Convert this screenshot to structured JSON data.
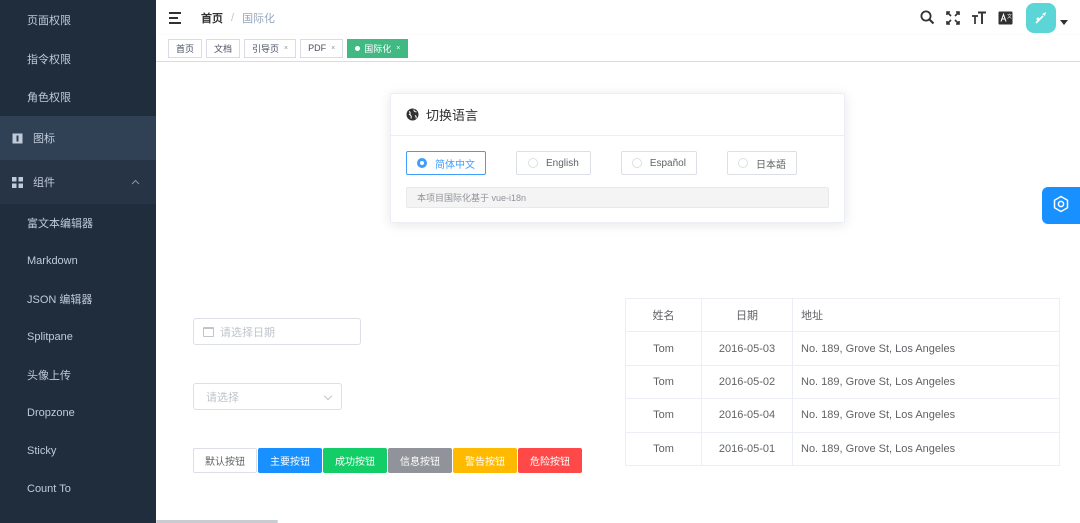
{
  "sidebar": {
    "items": [
      {
        "label": "页面权限"
      },
      {
        "label": "指令权限"
      },
      {
        "label": "角色权限"
      },
      {
        "label": "图标"
      },
      {
        "label": "组件"
      },
      {
        "label": "富文本编辑器"
      },
      {
        "label": "Markdown"
      },
      {
        "label": "JSON 编辑器"
      },
      {
        "label": "Splitpane"
      },
      {
        "label": "头像上传"
      },
      {
        "label": "Dropzone"
      },
      {
        "label": "Sticky"
      },
      {
        "label": "Count To"
      }
    ]
  },
  "breadcrumb": {
    "home": "首页",
    "separator": "/",
    "current": "国际化"
  },
  "tags": [
    {
      "label": "首页"
    },
    {
      "label": "文档"
    },
    {
      "label": "引导页"
    },
    {
      "label": "PDF"
    },
    {
      "label": "国际化"
    }
  ],
  "tag_close": "×",
  "card": {
    "title": "切换语言",
    "options": [
      {
        "label": "简体中文",
        "checked": true
      },
      {
        "label": "English",
        "checked": false
      },
      {
        "label": "Español",
        "checked": false
      },
      {
        "label": "日本語",
        "checked": false
      }
    ],
    "tip": "本项目国际化基于 vue-i18n"
  },
  "date_picker": {
    "placeholder": "请选择日期"
  },
  "select": {
    "placeholder": "请选择"
  },
  "buttons": [
    {
      "label": "默认按钮",
      "type": "default"
    },
    {
      "label": "主要按钮",
      "type": "primary"
    },
    {
      "label": "成功按钮",
      "type": "success"
    },
    {
      "label": "信息按钮",
      "type": "info"
    },
    {
      "label": "警告按钮",
      "type": "warning"
    },
    {
      "label": "危险按钮",
      "type": "danger"
    }
  ],
  "table": {
    "headers": [
      "姓名",
      "日期",
      "地址"
    ],
    "rows": [
      [
        "Tom",
        "2016-05-03",
        "No. 189, Grove St, Los Angeles"
      ],
      [
        "Tom",
        "2016-05-02",
        "No. 189, Grove St, Los Angeles"
      ],
      [
        "Tom",
        "2016-05-04",
        "No. 189, Grove St, Los Angeles"
      ],
      [
        "Tom",
        "2016-05-01",
        "No. 189, Grove St, Los Angeles"
      ]
    ]
  },
  "colors": {
    "sidebar_bg": "#1f2d3d",
    "active_tag": "#42b983",
    "primary": "#1890ff",
    "success": "#13ce66",
    "info": "#909399",
    "warning": "#ffba00",
    "danger": "#ff4949"
  },
  "icons": [
    "hamburger-icon",
    "search-icon",
    "fullscreen-icon",
    "text-size-icon",
    "translate-icon",
    "globe-icon",
    "calendar-icon",
    "chevron-down-icon",
    "gear-icon"
  ]
}
